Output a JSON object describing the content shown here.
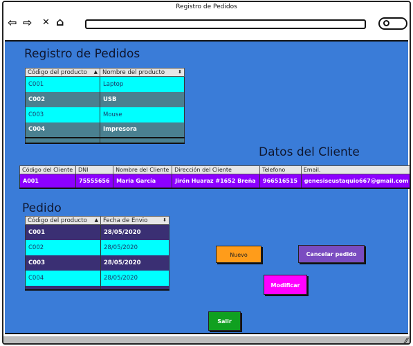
{
  "window": {
    "title": "Registro de Pedidos"
  },
  "toolbar": {
    "back_icon": "⇦",
    "forward_icon": "⇨",
    "close_icon": "✕",
    "home_icon": "⌂"
  },
  "products": {
    "title": "Registro de Pedidos",
    "headers": [
      "Código del producto",
      "Nombre del producto"
    ],
    "rows": [
      [
        "C001",
        "Laptop"
      ],
      [
        "C002",
        "USB"
      ],
      [
        "C003",
        "Mouse"
      ],
      [
        "C004",
        "Impresora"
      ]
    ]
  },
  "client": {
    "title": "Datos del Cliente",
    "headers": [
      "Código del Cliente",
      "DNI",
      "Nombre del Cliente",
      "Dirección del Cliente",
      "Telefono",
      "Email."
    ],
    "rows": [
      [
        "A001",
        "75555656",
        "Maria García",
        "Jirón Huaraz #1652 Breña",
        "966516515",
        "genesiseustaquio667@gmail.com"
      ]
    ]
  },
  "orders": {
    "title": "Pedido",
    "headers": [
      "Código del producto",
      "Fecha de Envio"
    ],
    "rows": [
      [
        "C001",
        "28/05/2020"
      ],
      [
        "C002",
        "28/05/2020"
      ],
      [
        "C003",
        "28/05/2020"
      ],
      [
        "C004",
        "28/05/2020"
      ]
    ]
  },
  "buttons": {
    "nuevo": "Nuevo",
    "cancelar": "Cancelar pedido",
    "modificar": "Modificar",
    "salir": "Salir"
  },
  "colors": {
    "background": "#3a7cd8",
    "row_cyan": "#00ffff",
    "row_teal": "#4a8090",
    "row_purple": "#8d00ff",
    "row_dark": "#3a2f73",
    "btn_nuevo": "#ff9c1a",
    "btn_cancelar": "#7a4cc0",
    "btn_modificar": "#ff00ff",
    "btn_salir": "#10a020"
  }
}
